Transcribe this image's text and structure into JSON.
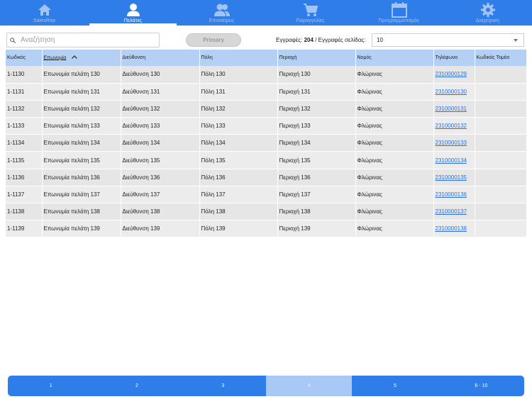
{
  "nav": {
    "items": [
      {
        "label": "SalesRep",
        "icon": "home-icon",
        "active": false
      },
      {
        "label": "Πελάτες",
        "icon": "person-icon",
        "active": true
      },
      {
        "label": "Επισκέψεις",
        "icon": "people-icon",
        "active": false
      },
      {
        "label": "Παραγγελίες",
        "icon": "cart-icon",
        "active": false
      },
      {
        "label": "Προγραμματισμός",
        "icon": "calendar-icon",
        "active": false
      },
      {
        "label": "Διαχείριση",
        "icon": "gear-icon",
        "active": false
      }
    ]
  },
  "toolbar": {
    "search_placeholder": "Αναζήτηση",
    "search_value": "",
    "primary_label": "Primary",
    "records_label": "Εγγραφές:",
    "records_count": "204",
    "per_page_label": "/ Εγγραφές σελίδας:",
    "per_page_value": "10"
  },
  "table": {
    "columns": [
      "Κωδικός",
      "Επωνυμία",
      "Διεύθυνση",
      "Πόλη",
      "Περιοχή",
      "Νομός",
      "Τηλέφωνο",
      "Κωδικός Τομέα"
    ],
    "sorted_column": "Επωνυμία",
    "sort_direction": "ascending",
    "rows": [
      {
        "code": "1-1130",
        "name": "Επωνυμία πελάτη 130",
        "address": "Διεύθυνση 130",
        "city": "Πόλη 130",
        "area": "Περιοχή 130",
        "prefecture": "Φλώρινας",
        "phone": "2310000129",
        "sector": ""
      },
      {
        "code": "1-1131",
        "name": "Επωνυμία πελάτη 131",
        "address": "Διεύθυνση 131",
        "city": "Πόλη 131",
        "area": "Περιοχή 131",
        "prefecture": "Φλώρινας",
        "phone": "2310000130",
        "sector": ""
      },
      {
        "code": "1-1132",
        "name": "Επωνυμία πελάτη 132",
        "address": "Διεύθυνση 132",
        "city": "Πόλη 132",
        "area": "Περιοχή 132",
        "prefecture": "Φλώρινας",
        "phone": "2310000131",
        "sector": ""
      },
      {
        "code": "1-1133",
        "name": "Επωνυμία πελάτη 133",
        "address": "Διεύθυνση 133",
        "city": "Πόλη 133",
        "area": "Περιοχή 133",
        "prefecture": "Φλώρινας",
        "phone": "2310000132",
        "sector": ""
      },
      {
        "code": "1-1134",
        "name": "Επωνυμία πελάτη 134",
        "address": "Διεύθυνση 134",
        "city": "Πόλη 134",
        "area": "Περιοχή 134",
        "prefecture": "Φλώρινας",
        "phone": "2310000133",
        "sector": ""
      },
      {
        "code": "1-1135",
        "name": "Επωνυμία πελάτη 135",
        "address": "Διεύθυνση 135",
        "city": "Πόλη 135",
        "area": "Περιοχή 135",
        "prefecture": "Φλώρινας",
        "phone": "2310000134",
        "sector": ""
      },
      {
        "code": "1-1136",
        "name": "Επωνυμία πελάτη 136",
        "address": "Διεύθυνση 136",
        "city": "Πόλη 136",
        "area": "Περιοχή 136",
        "prefecture": "Φλώρινας",
        "phone": "2310000135",
        "sector": ""
      },
      {
        "code": "1-1137",
        "name": "Επωνυμία πελάτη 137",
        "address": "Διεύθυνση 137",
        "city": "Πόλη 137",
        "area": "Περιοχή 137",
        "prefecture": "Φλώρινας",
        "phone": "2310000136",
        "sector": ""
      },
      {
        "code": "1-1138",
        "name": "Επωνυμία πελάτη 138",
        "address": "Διεύθυνση 138",
        "city": "Πόλη 138",
        "area": "Περιοχή 138",
        "prefecture": "Φλώρινας",
        "phone": "2310000137",
        "sector": ""
      },
      {
        "code": "1-1139",
        "name": "Επωνυμία πελάτη 139",
        "address": "Διεύθυνση 139",
        "city": "Πόλη 139",
        "area": "Περιοχή 139",
        "prefecture": "Φλώρινας",
        "phone": "2310000138",
        "sector": ""
      }
    ]
  },
  "pagination": {
    "pages": [
      "1",
      "2",
      "3",
      "4",
      "5",
      "6 - 10"
    ],
    "current": "4"
  },
  "colors": {
    "accent": "#2f7de8",
    "header_bg": "#b5d0f5",
    "current_page": "#a8c8f5",
    "link": "#2a6fdb"
  }
}
